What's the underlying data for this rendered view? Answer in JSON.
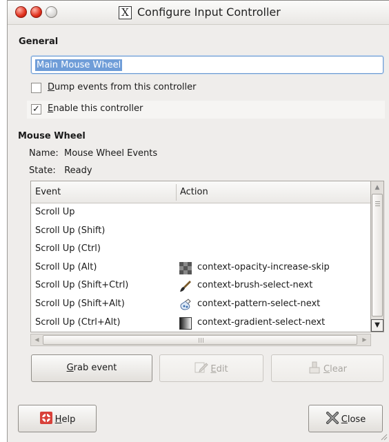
{
  "window": {
    "title": "Configure Input Controller"
  },
  "general": {
    "heading": "General",
    "name_value": "Main Mouse Wheel",
    "dump_events": {
      "label": "ump events from this controller",
      "mnemonic": "D",
      "checked": false
    },
    "enable_controller": {
      "label": "nable this controller",
      "mnemonic": "E",
      "checked": true
    }
  },
  "mouse_wheel": {
    "heading": "Mouse Wheel",
    "name_label": "Name:",
    "name_value": "Mouse Wheel Events",
    "state_label": "State:",
    "state_value": "Ready"
  },
  "table": {
    "columns": [
      "Event",
      "Action"
    ],
    "rows": [
      {
        "event": "Scroll Up",
        "action": "",
        "icon": ""
      },
      {
        "event": "Scroll Up (Shift)",
        "action": "",
        "icon": ""
      },
      {
        "event": "Scroll Up (Ctrl)",
        "action": "",
        "icon": ""
      },
      {
        "event": "Scroll Up (Alt)",
        "action": "context-opacity-increase-skip",
        "icon": "opacity-icon"
      },
      {
        "event": "Scroll Up (Shift+Ctrl)",
        "action": "context-brush-select-next",
        "icon": "brush-icon"
      },
      {
        "event": "Scroll Up (Shift+Alt)",
        "action": "context-pattern-select-next",
        "icon": "pattern-icon"
      },
      {
        "event": "Scroll Up (Ctrl+Alt)",
        "action": "context-gradient-select-next",
        "icon": "gradient-icon"
      }
    ]
  },
  "buttons": {
    "grab": {
      "mnemonic": "G",
      "label": "rab event"
    },
    "edit": {
      "mnemonic": "E",
      "label": "dit"
    },
    "clear": {
      "mnemonic": "C",
      "label": "lear"
    },
    "help": {
      "mnemonic": "H",
      "label": "elp"
    },
    "close": {
      "mnemonic": "C",
      "label": "lose"
    }
  },
  "colors": {
    "selection": "#6f9dd8",
    "window_bg": "#efedeb"
  }
}
